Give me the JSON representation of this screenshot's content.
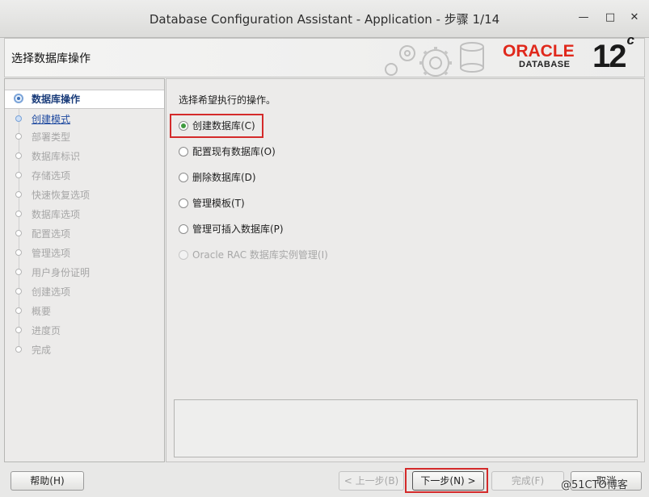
{
  "window": {
    "title": "Database Configuration Assistant - Application - 步骤 1/14",
    "minimize_icon": "minimize-icon",
    "maximize_icon": "maximize-icon",
    "close_icon": "close-icon"
  },
  "header": {
    "title": "选择数据库操作",
    "logo_brand": "ORACLE",
    "logo_product": "DATABASE",
    "logo_version": "12",
    "logo_version_suffix": "c",
    "brand_color": "#e0281b"
  },
  "steps": [
    {
      "label": "数据库操作",
      "state": "active"
    },
    {
      "label": "创建模式",
      "state": "link"
    },
    {
      "label": "部署类型",
      "state": "disabled"
    },
    {
      "label": "数据库标识",
      "state": "disabled"
    },
    {
      "label": "存储选项",
      "state": "disabled"
    },
    {
      "label": "快速恢复选项",
      "state": "disabled"
    },
    {
      "label": "数据库选项",
      "state": "disabled"
    },
    {
      "label": "配置选项",
      "state": "disabled"
    },
    {
      "label": "管理选项",
      "state": "disabled"
    },
    {
      "label": "用户身份证明",
      "state": "disabled"
    },
    {
      "label": "创建选项",
      "state": "disabled"
    },
    {
      "label": "概要",
      "state": "disabled"
    },
    {
      "label": "进度页",
      "state": "disabled"
    },
    {
      "label": "完成",
      "state": "disabled"
    }
  ],
  "main": {
    "prompt": "选择希望执行的操作。",
    "options": [
      {
        "label": "创建数据库(C)",
        "selected": true,
        "enabled": true
      },
      {
        "label": "配置现有数据库(O)",
        "selected": false,
        "enabled": true
      },
      {
        "label": "删除数据库(D)",
        "selected": false,
        "enabled": true
      },
      {
        "label": "管理模板(T)",
        "selected": false,
        "enabled": true
      },
      {
        "label": "管理可插入数据库(P)",
        "selected": false,
        "enabled": true
      },
      {
        "label": "Oracle RAC 数据库实例管理(I)",
        "selected": false,
        "enabled": false
      }
    ]
  },
  "buttons": {
    "help": "帮助(H)",
    "back": "< 上一步(B)",
    "next": "下一步(N) >",
    "finish": "完成(F)",
    "cancel": "取消"
  },
  "watermark": "@51CTO博客",
  "highlight_color": "#d42a2a",
  "selected_radio_color": "#3f9a3f"
}
